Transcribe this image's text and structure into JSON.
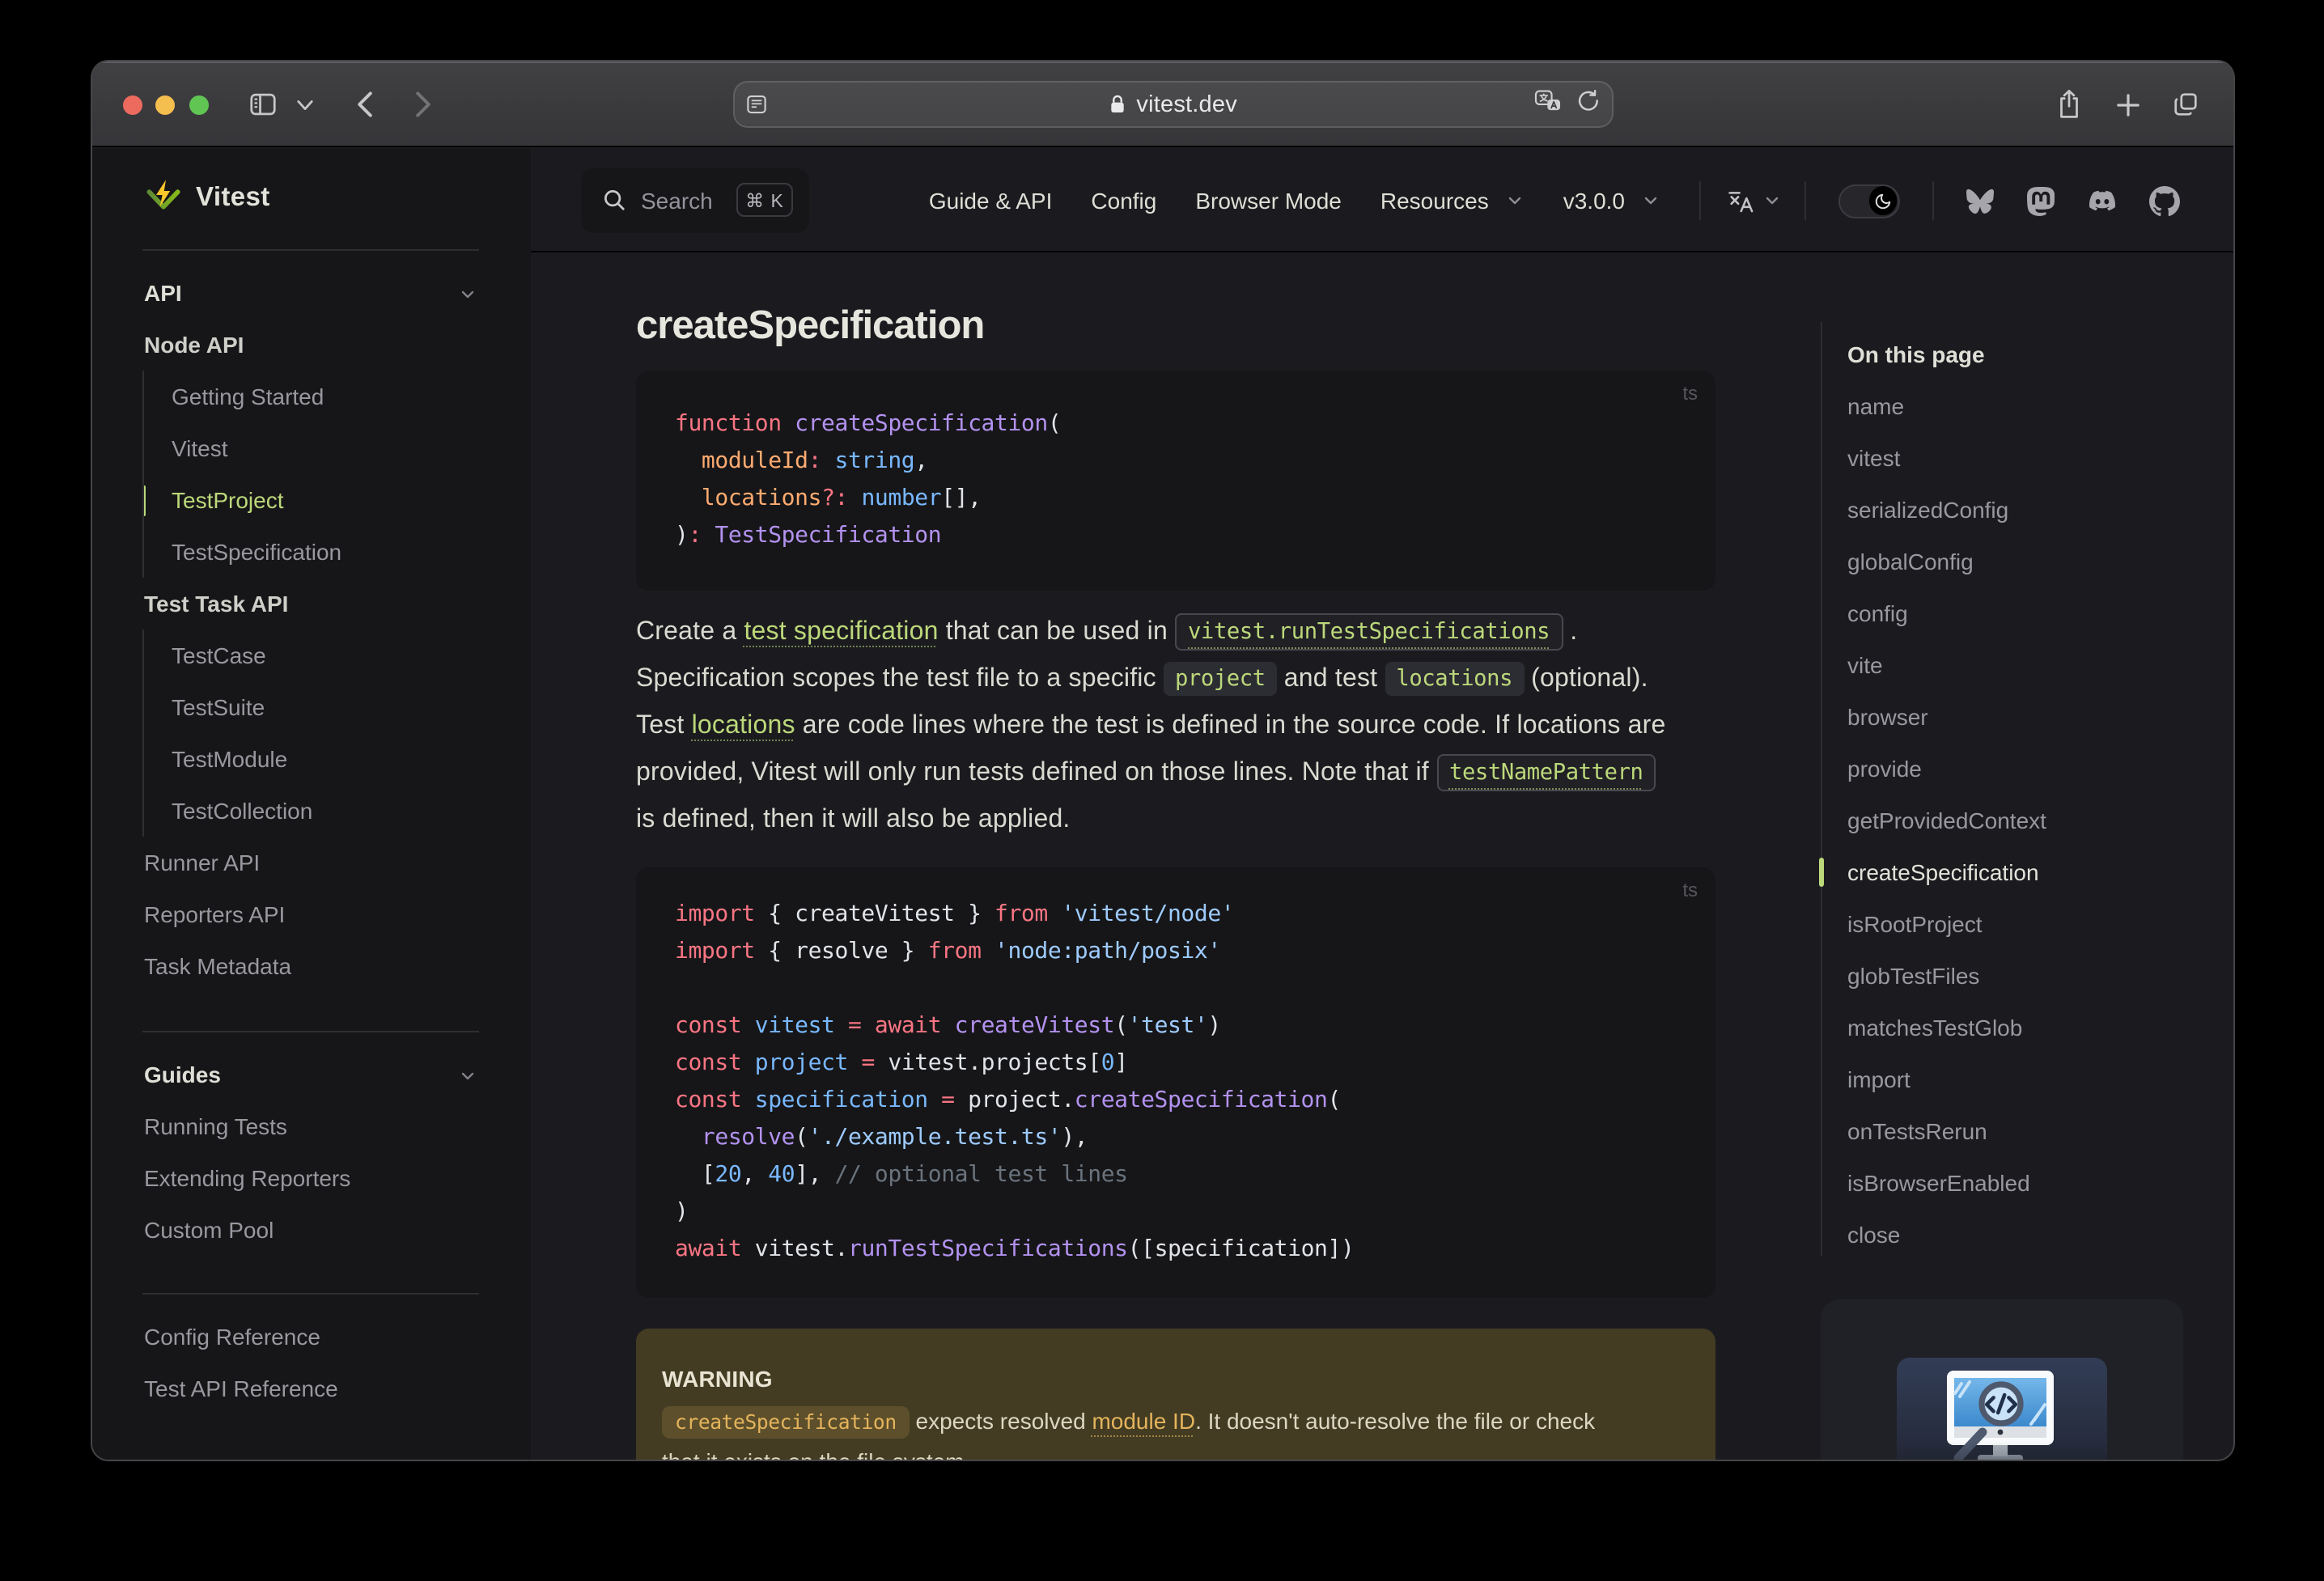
{
  "colors": {
    "bg": "#1b1b1f",
    "bg_alt": "#161618",
    "bg_soft": "#202127",
    "divider": "#2e2e32",
    "brand_green": "#bcd87a",
    "traffic_red": "#ed6a5e",
    "traffic_yellow": "#f5bf4f",
    "traffic_green": "#61c554",
    "logo_yellow": "#fcc72b",
    "logo_green_dark": "#5f8a34",
    "logo_green_light": "#86b91a",
    "token_keyword": "#f97583",
    "token_function": "#b392f0",
    "token_param": "#ffab70",
    "token_type": "#79b8ff",
    "token_string": "#9ecbff",
    "token_punct": "#e1e4e8",
    "token_comment": "#6a737d"
  },
  "browser": {
    "url_host": "vitest.dev",
    "lock_icon": "lock-icon",
    "toolbar_icons": [
      "sidebar-toggle-icon",
      "tab-group-chevron-icon",
      "back-icon",
      "forward-icon",
      "reader-icon",
      "translate-icon",
      "reload-icon",
      "share-icon",
      "new-tab-icon",
      "tab-overview-icon"
    ]
  },
  "nav": {
    "search": {
      "label": "Search",
      "kbd": "⌘ K"
    },
    "links": [
      {
        "label": "Guide & API",
        "chevron": false
      },
      {
        "label": "Config",
        "chevron": false
      },
      {
        "label": "Browser Mode",
        "chevron": false
      },
      {
        "label": "Resources",
        "chevron": true
      },
      {
        "label": "v3.0.0",
        "chevron": true
      }
    ],
    "social": [
      "bluesky",
      "mastodon",
      "discord",
      "github"
    ]
  },
  "sidebar": {
    "brand": "Vitest",
    "groups": [
      {
        "title": "API",
        "entries": [
          {
            "label": "Node API",
            "type": "section"
          },
          {
            "label": "Getting Started",
            "type": "child"
          },
          {
            "label": "Vitest",
            "type": "child"
          },
          {
            "label": "TestProject",
            "type": "child",
            "active": true
          },
          {
            "label": "TestSpecification",
            "type": "child"
          },
          {
            "label": "Test Task API",
            "type": "section"
          },
          {
            "label": "TestCase",
            "type": "child"
          },
          {
            "label": "TestSuite",
            "type": "child"
          },
          {
            "label": "TestModule",
            "type": "child"
          },
          {
            "label": "TestCollection",
            "type": "child"
          },
          {
            "label": "Runner API",
            "type": "item"
          },
          {
            "label": "Reporters API",
            "type": "item"
          },
          {
            "label": "Task Metadata",
            "type": "item"
          }
        ]
      },
      {
        "title": "Guides",
        "entries": [
          {
            "label": "Running Tests",
            "type": "item"
          },
          {
            "label": "Extending Reporters",
            "type": "item"
          },
          {
            "label": "Custom Pool",
            "type": "item"
          }
        ]
      },
      {
        "title": null,
        "entries": [
          {
            "label": "Config Reference",
            "type": "item"
          },
          {
            "label": "Test API Reference",
            "type": "item"
          }
        ]
      }
    ]
  },
  "doc": {
    "h1": "createSpecification",
    "code_blocks": [
      {
        "lang": "ts",
        "lines": [
          [
            {
              "t": "function ",
              "c": "kw"
            },
            {
              "t": "createSpecification",
              "c": "fn"
            },
            {
              "t": "(",
              "c": "pn"
            }
          ],
          [
            {
              "t": "  moduleId",
              "c": "pr"
            },
            {
              "t": ":",
              "c": "kw"
            },
            {
              "t": " string",
              "c": "ty"
            },
            {
              "t": ",",
              "c": "pn"
            }
          ],
          [
            {
              "t": "  locations",
              "c": "pr"
            },
            {
              "t": "?:",
              "c": "kw"
            },
            {
              "t": " number",
              "c": "ty"
            },
            {
              "t": "[],",
              "c": "pn"
            }
          ],
          [
            {
              "t": ")",
              "c": "pn"
            },
            {
              "t": ":",
              "c": "kw"
            },
            {
              "t": " TestSpecification",
              "c": "fn"
            }
          ]
        ]
      },
      {
        "lang": "ts",
        "lines": [
          [
            {
              "t": "import",
              "c": "kw"
            },
            {
              "t": " { ",
              "c": "pn"
            },
            {
              "t": "createVitest",
              "c": "pl"
            },
            {
              "t": " } ",
              "c": "pn"
            },
            {
              "t": "from",
              "c": "kw"
            },
            {
              "t": " ",
              "c": "pn"
            },
            {
              "t": "'vitest/node'",
              "c": "st"
            }
          ],
          [
            {
              "t": "import",
              "c": "kw"
            },
            {
              "t": " { ",
              "c": "pn"
            },
            {
              "t": "resolve",
              "c": "pl"
            },
            {
              "t": " } ",
              "c": "pn"
            },
            {
              "t": "from",
              "c": "kw"
            },
            {
              "t": " ",
              "c": "pn"
            },
            {
              "t": "'node:path/posix'",
              "c": "st"
            }
          ],
          [],
          [
            {
              "t": "const",
              "c": "kw"
            },
            {
              "t": " vitest",
              "c": "ty"
            },
            {
              "t": " = ",
              "c": "kw"
            },
            {
              "t": "await",
              "c": "kw"
            },
            {
              "t": " createVitest",
              "c": "fn"
            },
            {
              "t": "(",
              "c": "pn"
            },
            {
              "t": "'test'",
              "c": "st"
            },
            {
              "t": ")",
              "c": "pn"
            }
          ],
          [
            {
              "t": "const",
              "c": "kw"
            },
            {
              "t": " project",
              "c": "ty"
            },
            {
              "t": " = ",
              "c": "kw"
            },
            {
              "t": "vitest",
              "c": "pl"
            },
            {
              "t": ".",
              "c": "pn"
            },
            {
              "t": "projects",
              "c": "pl"
            },
            {
              "t": "[",
              "c": "pn"
            },
            {
              "t": "0",
              "c": "ty"
            },
            {
              "t": "]",
              "c": "pn"
            }
          ],
          [
            {
              "t": "const",
              "c": "kw"
            },
            {
              "t": " specification",
              "c": "ty"
            },
            {
              "t": " = ",
              "c": "kw"
            },
            {
              "t": "project",
              "c": "pl"
            },
            {
              "t": ".",
              "c": "pn"
            },
            {
              "t": "createSpecification",
              "c": "fn"
            },
            {
              "t": "(",
              "c": "pn"
            }
          ],
          [
            {
              "t": "  resolve",
              "c": "fn"
            },
            {
              "t": "(",
              "c": "pn"
            },
            {
              "t": "'./example.test.ts'",
              "c": "st"
            },
            {
              "t": "),",
              "c": "pn"
            }
          ],
          [
            {
              "t": "  [",
              "c": "pn"
            },
            {
              "t": "20",
              "c": "ty"
            },
            {
              "t": ", ",
              "c": "pn"
            },
            {
              "t": "40",
              "c": "ty"
            },
            {
              "t": "], ",
              "c": "pn"
            },
            {
              "t": "// optional test lines",
              "c": "cm"
            }
          ],
          [
            {
              "t": ")",
              "c": "pn"
            }
          ],
          [
            {
              "t": "await",
              "c": "kw"
            },
            {
              "t": " vitest",
              "c": "pl"
            },
            {
              "t": ".",
              "c": "pn"
            },
            {
              "t": "runTestSpecifications",
              "c": "fn"
            },
            {
              "t": "([",
              "c": "pn"
            },
            {
              "t": "specification",
              "c": "pl"
            },
            {
              "t": "])",
              "c": "pn"
            }
          ]
        ]
      }
    ],
    "paragraph_lines": [
      [
        {
          "t": "Create a ",
          "s": "text"
        },
        {
          "t": "test specification",
          "s": "link"
        },
        {
          "t": " that can be used in ",
          "s": "text"
        },
        {
          "t": "vitest.runTestSpecifications",
          "s": "codelink"
        },
        {
          "t": " .",
          "s": "text"
        }
      ],
      [
        {
          "t": "Specification scopes the test file to a specific ",
          "s": "text"
        },
        {
          "t": "project",
          "s": "code"
        },
        {
          "t": " and test ",
          "s": "text"
        },
        {
          "t": "locations",
          "s": "code"
        },
        {
          "t": " (optional).",
          "s": "text"
        }
      ],
      [
        {
          "t": "Test ",
          "s": "text"
        },
        {
          "t": "locations",
          "s": "link"
        },
        {
          "t": " are code lines where the test is defined in the source code. If locations are",
          "s": "text"
        }
      ],
      [
        {
          "t": "provided, Vitest will only run tests defined on those lines. Note that if ",
          "s": "text"
        },
        {
          "t": "testNamePattern",
          "s": "codelink"
        }
      ],
      [
        {
          "t": "is defined, then it will also be applied.",
          "s": "text"
        }
      ]
    ],
    "warning": {
      "title": "WARNING",
      "lines": [
        [
          {
            "t": "createSpecification",
            "s": "code"
          },
          {
            "t": " expects resolved ",
            "s": "text"
          },
          {
            "t": "module ID",
            "s": "link"
          },
          {
            "t": ". It doesn't auto-resolve the file or check",
            "s": "text"
          }
        ],
        [
          {
            "t": "that it exists on the file system.",
            "s": "text"
          }
        ]
      ]
    }
  },
  "outline": {
    "title": "On this page",
    "items": [
      "name",
      "vitest",
      "serializedConfig",
      "globalConfig",
      "config",
      "vite",
      "browser",
      "provide",
      "getProvidedContext",
      "createSpecification",
      "isRootProject",
      "globTestFiles",
      "matchesTestGlob",
      "import",
      "onTestsRerun",
      "isBrowserEnabled",
      "close"
    ],
    "active": "createSpecification"
  },
  "ad_card": {
    "image": "code-search-monitor-illustration"
  }
}
